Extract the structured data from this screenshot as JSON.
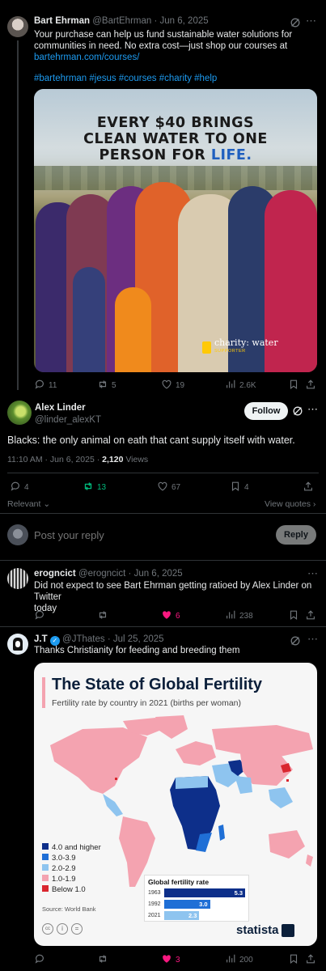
{
  "tweet1": {
    "name": "Bart Ehrman",
    "handle": "@BartEhrman",
    "dot": "·",
    "date": "Jun 6, 2025",
    "text_line1": "Your purchase can help us fund sustainable water solutions for",
    "text_line2": "communities in need. No extra cost—just shop our courses at",
    "link": "bartehrman.com/courses/",
    "hashtags": "#bartehrman #jesus #courses #charity #help",
    "image_headline_1": "EVERY $40 BRINGS",
    "image_headline_2": "CLEAN WATER TO ONE",
    "image_headline_3a": "PERSON FOR ",
    "image_headline_3b": "LIFE.",
    "image_logo_text": "charity: water",
    "image_logo_sub": "SUPPORTER",
    "replies": "11",
    "reposts": "5",
    "likes": "19",
    "views": "2.6K"
  },
  "tweet2": {
    "name": "Alex Linder",
    "handle": "@linder_alexKT",
    "follow_label": "Follow",
    "text": "Blacks: the only animal on eath that cant supply itself with water.",
    "time": "11:10 AM · Jun 6, 2025 · ",
    "views_count": "2,120",
    "views_label": " Views",
    "replies": "4",
    "reposts": "13",
    "likes": "67",
    "bookmarks": "4",
    "relevant_label": "Relevant",
    "view_quotes_label": "View quotes"
  },
  "composer": {
    "placeholder": "Post your reply",
    "reply_label": "Reply"
  },
  "reply1": {
    "name": "erogncict",
    "handle": "@erogncict",
    "dot": "·",
    "date": "Jun 6, 2025",
    "text_line1": "Did not expect to see Bart Ehrman getting ratioed by Alex Linder on Twitter",
    "text_line2": "today",
    "likes": "6",
    "views": "238"
  },
  "reply2": {
    "name": "J.T",
    "handle": "@JThates",
    "dot": "·",
    "date": "Jul 25, 2025",
    "text": "Thanks Christianity for feeding and breeding them",
    "likes": "3",
    "views": "200",
    "infographic": {
      "title": "The State of Global Fertility",
      "subtitle": "Fertility rate by country in 2021 (births per woman)",
      "legend": [
        {
          "label": "4.0 and higher",
          "color": "#0d2f8a"
        },
        {
          "label": "3.0-3.9",
          "color": "#1f6fd6"
        },
        {
          "label": "2.0-2.9",
          "color": "#8ec4ef"
        },
        {
          "label": "1.0-1.9",
          "color": "#f4a3b0"
        },
        {
          "label": "Below 1.0",
          "color": "#d9262f"
        }
      ],
      "source": "Source: World Bank",
      "brand": "statista",
      "inset_title": "Global fertility rate",
      "inset_rows": [
        {
          "year": "1963",
          "value": "5.3",
          "v": 5.3
        },
        {
          "year": "1992",
          "value": "3.0",
          "v": 3.0
        },
        {
          "year": "2021",
          "value": "2.3",
          "v": 2.3
        }
      ]
    }
  },
  "colors": {
    "accent": "#1d9bf0",
    "repost_green": "#00ba7c",
    "like_pink": "#f91880",
    "muted": "#71767b",
    "divider": "#2f3336"
  }
}
